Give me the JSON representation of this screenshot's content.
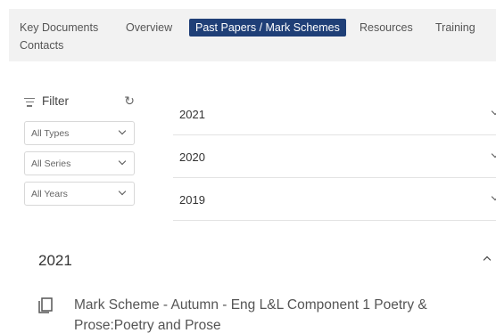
{
  "tabs": [
    {
      "label": "Key Documents",
      "active": false
    },
    {
      "label": "Overview",
      "active": false
    },
    {
      "label": "Past Papers / Mark Schemes",
      "active": true
    },
    {
      "label": "Resources",
      "active": false
    },
    {
      "label": "Training",
      "active": false
    },
    {
      "label": "Contacts",
      "active": false
    }
  ],
  "filter": {
    "label": "Filter",
    "types": "All Types",
    "series": "All Series",
    "years": "All Years"
  },
  "years": [
    "2021",
    "2020",
    "2019"
  ],
  "expanded": {
    "year": "2021",
    "documents": [
      {
        "title": "Mark Scheme - Autumn - Eng L&L Component 1 Poetry & Prose:Poetry and Prose"
      }
    ]
  },
  "colors": {
    "active_tab_bg": "#1f3f77",
    "tabbar_bg": "#f2f2f2"
  }
}
